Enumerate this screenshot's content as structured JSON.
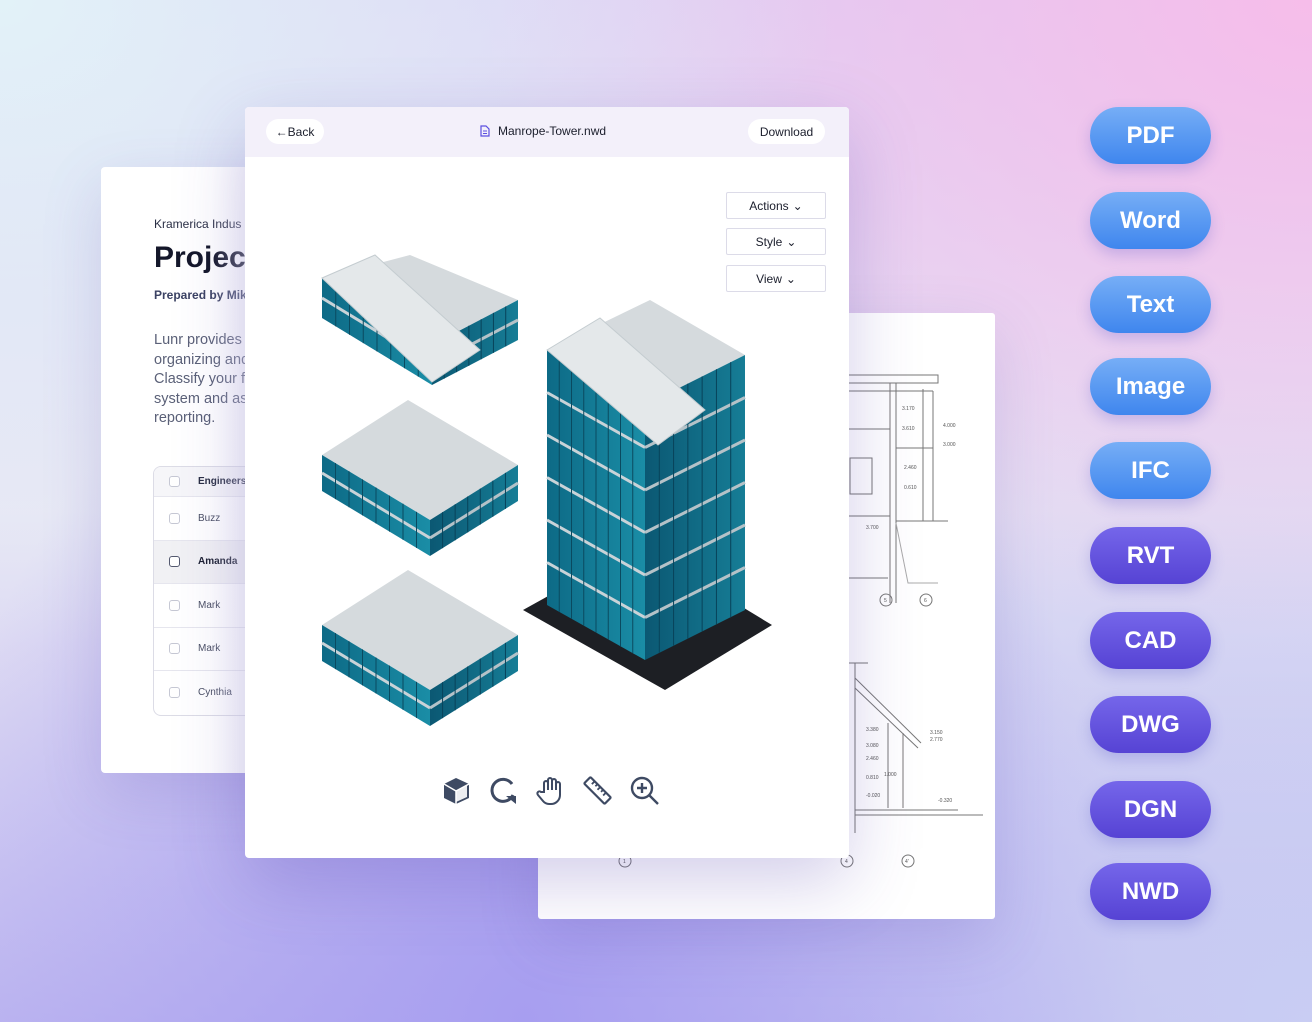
{
  "doc": {
    "company": "Kramerica Indus",
    "title": "Projec",
    "prepared_by": "Prepared by Mik",
    "paragraph": [
      "Lunr provides",
      "organizing and",
      "Classify your f",
      "system and as",
      "reporting."
    ],
    "table": {
      "header": "Engineers",
      "rows": [
        "Buzz",
        "Amanda",
        "Mark",
        "Mark",
        "Cynthia"
      ],
      "selected_row": "Amanda"
    }
  },
  "blueprint": {
    "upper_labels": [
      "3.170",
      "3.610",
      "4.000",
      "3.000",
      "2.460",
      "0.610",
      "3.700"
    ],
    "upper_axes": [
      "5",
      "6"
    ],
    "lower_labels": [
      "3.380",
      "3.080",
      "2.460",
      "0.810",
      "1.000",
      "-0.020",
      "3.150",
      "2.770",
      "-0.320"
    ],
    "lower_axes": [
      "1",
      "4",
      "4'"
    ]
  },
  "viewer": {
    "back_label": "Back",
    "file_name": "Manrope-Tower.nwd",
    "download_label": "Download",
    "dropdowns": [
      "Actions",
      "Style",
      "View"
    ],
    "tools": [
      "cube-icon",
      "rotate-icon",
      "hand-pan-icon",
      "ruler-measure-icon",
      "zoom-in-icon"
    ]
  },
  "formats": [
    {
      "label": "PDF",
      "color": "blue"
    },
    {
      "label": "Word",
      "color": "blue"
    },
    {
      "label": "Text",
      "color": "blue"
    },
    {
      "label": "Image",
      "color": "blue"
    },
    {
      "label": "IFC",
      "color": "blue"
    },
    {
      "label": "RVT",
      "color": "purple"
    },
    {
      "label": "CAD",
      "color": "purple"
    },
    {
      "label": "DWG",
      "color": "purple"
    },
    {
      "label": "DGN",
      "color": "purple"
    },
    {
      "label": "NWD",
      "color": "purple"
    }
  ],
  "colors": {
    "blue_pill": "#3f86ee",
    "purple_pill": "#5643d4",
    "header_bg": "#f3f0fa",
    "icon": "#3e4a63",
    "file_icon": "#5b4fe0"
  }
}
